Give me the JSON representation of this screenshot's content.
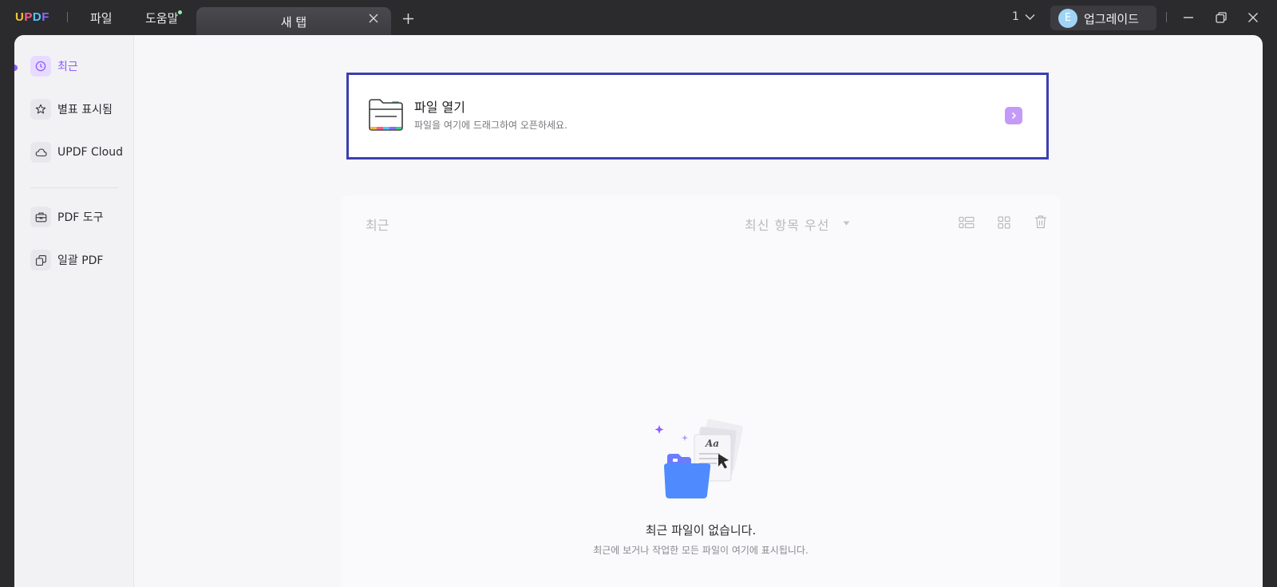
{
  "app": {
    "logo": "UPDF",
    "menus": [
      "파일",
      "도움말"
    ],
    "tab_label": "새 탭",
    "window_count": "1",
    "avatar_initial": "E",
    "upgrade_label": "업그레이드"
  },
  "sidebar": {
    "items": [
      {
        "label": "최근",
        "icon": "clock-icon"
      },
      {
        "label": "별표 표시됨",
        "icon": "star-icon"
      },
      {
        "label": "UPDF Cloud",
        "icon": "cloud-icon"
      },
      {
        "label": "PDF 도구",
        "icon": "toolbox-icon"
      },
      {
        "label": "일괄 PDF",
        "icon": "batch-icon"
      }
    ]
  },
  "open_file": {
    "title": "파일 열기",
    "subtitle": "파일을 여기에 드래그하여 오픈하세요."
  },
  "recent": {
    "title": "최근",
    "sort_label": "최신 항목 우선",
    "empty_title": "최근 파일이 없습니다.",
    "empty_subtitle": "최근에 보거나 작업한 모든 파일이 여기에 표시됩니다."
  },
  "colors": {
    "accent": "#8e5cff",
    "highlight_border": "#3b3fb0",
    "titlebar": "#2b2b2d"
  }
}
